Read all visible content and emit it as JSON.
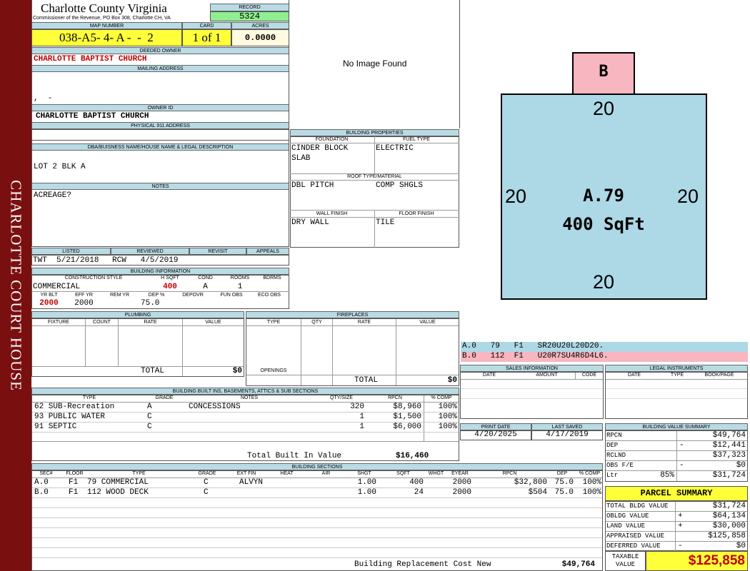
{
  "sidebar": {
    "text": "CHARLOTTE COURT HOUSE"
  },
  "header": {
    "county": "Charlotte County Virginia",
    "address": "Commissioner of the Revenue, PO Box 308, Charlotte CH, VA",
    "record_label": "RECORD",
    "record": "5324",
    "map_label": "MAP NUMBER",
    "map_number": "038-A5- 4- A -  -  2",
    "card_label": "CARD",
    "card": "1 of 1",
    "acres_label": "ACRES",
    "acres": "0.0000"
  },
  "owner": {
    "deeded_label": "DEEDED OWNER",
    "deeded": "CHARLOTTE BAPTIST CHURCH",
    "mailing_label": "MAILING ADDRESS",
    "mailing": ",  -",
    "id_label": "OWNER ID",
    "id": "CHARLOTTE BAPTIST CHURCH",
    "physical_label": "PHYSICAL 911 ADDRESS",
    "dba_label": "DBA/BUISNESS NAME/HOUSE NAME & LEGAL DESCRIPTION",
    "dba": "LOT 2 BLK A",
    "notes_label": "NOTES",
    "notes": "ACREAGE?"
  },
  "image": {
    "text": "No Image Found"
  },
  "dates": {
    "listed_label": "LISTED",
    "listed": "TWT  5/21/2018",
    "reviewed_label": "REVIEWED",
    "reviewed": "RCW   4/5/2019",
    "revisit_label": "REVISIT",
    "appeals_label": "APPEALS"
  },
  "building_info": {
    "label": "BUILDING INFORMATION",
    "style_label": "CONSTRUCTION STYLE",
    "style": "COMMERCIAL",
    "hsqft_label": "H SQFT",
    "hsqft": "400",
    "cond_label": "COND",
    "cond": "A",
    "rooms_label": "ROOMS",
    "rooms": "1",
    "bdrms_label": "BDRMS",
    "yrblt_label": "YR BLT",
    "yrblt": "2000",
    "effyr_label": "EFF YR",
    "effyr": "2000",
    "remyr_label": "REM YR",
    "dep_label": "DEP %",
    "dep": "75.0",
    "depovr_label": "DEPOVR",
    "funobs_label": "FUN OBS",
    "ecoobs_label": "ECO OBS"
  },
  "props": {
    "label": "BUILDING PROPERTIES",
    "foundation_label": "FOUNDATION",
    "foundation1": "CINDER BLOCK",
    "foundation2": "SLAB",
    "fuel_label": "FUEL TYPE",
    "fuel": "ELECTRIC",
    "roof_label": "ROOF TYPE/MATERIAL",
    "roof1": "DBL PITCH",
    "roof2": "COMP SHGLS",
    "wall_label": "WALL FINISH",
    "wall": "DRY WALL",
    "floor_label": "FLOOR FINISH",
    "floor": "TILE"
  },
  "sketch": {
    "top_label": "B",
    "top": "20",
    "left": "20",
    "right": "20",
    "bottom": "20",
    "area_code": "A.79",
    "area": "400 SqFt",
    "line_a": "A.0   79   F1   SR20U20L20D20.",
    "line_b": "B.0   112  F1   U20R7SU4R6D4L6."
  },
  "plumbing": {
    "label": "PLUMBING",
    "cols": [
      "FIXTURE",
      "COUNT",
      "RATE",
      "VALUE"
    ],
    "total_label": "TOTAL",
    "total": "$0"
  },
  "fireplaces": {
    "label": "FIREPLACES",
    "cols": [
      "TYPE",
      "QTY",
      "RATE",
      "VALUE"
    ],
    "openings_label": "OPENINGS",
    "total_label": "TOTAL",
    "total": "$0"
  },
  "sales": {
    "label": "SALES INFORMATION",
    "cols": [
      "DATE",
      "AMOUNT",
      "CODE"
    ]
  },
  "legal": {
    "label": "LEGAL INSTRUMENTS",
    "cols": [
      "DATE",
      "TYPE",
      "BOOK/PAGE"
    ]
  },
  "builtins": {
    "label": "BUILDING BUILT INS, BASEMENTS, ATTICS & SUB SECTIONS",
    "cols": [
      "TYPE",
      "GRADE",
      "NOTES",
      "QTY/SIZE",
      "RPCN",
      "% COMP"
    ],
    "rows": [
      [
        "62 SUB-Recreation",
        "A",
        "CONCESSIONS",
        "320",
        "$8,960",
        "100%"
      ],
      [
        "93 PUBLIC WATER",
        "C",
        "",
        "1",
        "$1,500",
        "100%"
      ],
      [
        "91 SEPTIC",
        "C",
        "",
        "1",
        "$6,000",
        "100%"
      ]
    ],
    "total_label": "Total Built In Value",
    "total": "$16,460"
  },
  "print": {
    "print_label": "PRINT DATE",
    "print": "4/20/2025",
    "saved_label": "LAST SAVED",
    "saved": "4/17/2019"
  },
  "bvs": {
    "label": "BUILDING VALUE SUMMARY",
    "rows": [
      [
        "RPCN",
        "",
        "",
        "$49,764"
      ],
      [
        "DEP",
        "",
        "-",
        "$12,441"
      ],
      [
        "RCLND",
        "",
        "",
        "$37,323"
      ],
      [
        "OBS F/E",
        "",
        "-",
        "$0"
      ],
      [
        "Ltr",
        "85%",
        "",
        "$31,724"
      ]
    ]
  },
  "sections": {
    "label": "BUILDING SECTIONS",
    "cols": [
      "SEC#",
      "FLOOR",
      "TYPE",
      "GRADE",
      "EXT FIN",
      "HEAT",
      "AIR",
      "SHGT",
      "SQFT",
      "WHGT",
      "EYEAR",
      "RPCN",
      "DEP",
      "% COMP"
    ],
    "rows": [
      [
        "A.0",
        "F1",
        "79 COMMERCIAL",
        "C",
        "ALVYN",
        "",
        "",
        "1.00",
        "400",
        "",
        "2000",
        "$32,800",
        "75.0",
        "100%"
      ],
      [
        "B.0",
        "F1",
        "112 WOOD DECK",
        "C",
        "",
        "",
        "",
        "1.00",
        "24",
        "",
        "2000",
        "$504",
        "75.0",
        "100%"
      ]
    ],
    "total_label": "Building Replacement Cost New",
    "total": "$49,764"
  },
  "parcel": {
    "label": "PARCEL SUMMARY",
    "rows": [
      [
        "TOTAL BLDG VALUE",
        "",
        "$31,724"
      ],
      [
        "OBLDG VALUE",
        "+",
        "$64,134"
      ],
      [
        "LAND VALUE",
        "+",
        "$30,000"
      ],
      [
        "APPRAISED VALUE",
        "",
        "$125,858"
      ],
      [
        "DEFERRED VALUE",
        "-",
        "$0"
      ]
    ],
    "taxable_label1": "TAXABLE",
    "taxable_label2": "VALUE",
    "taxable": "$125,858"
  }
}
